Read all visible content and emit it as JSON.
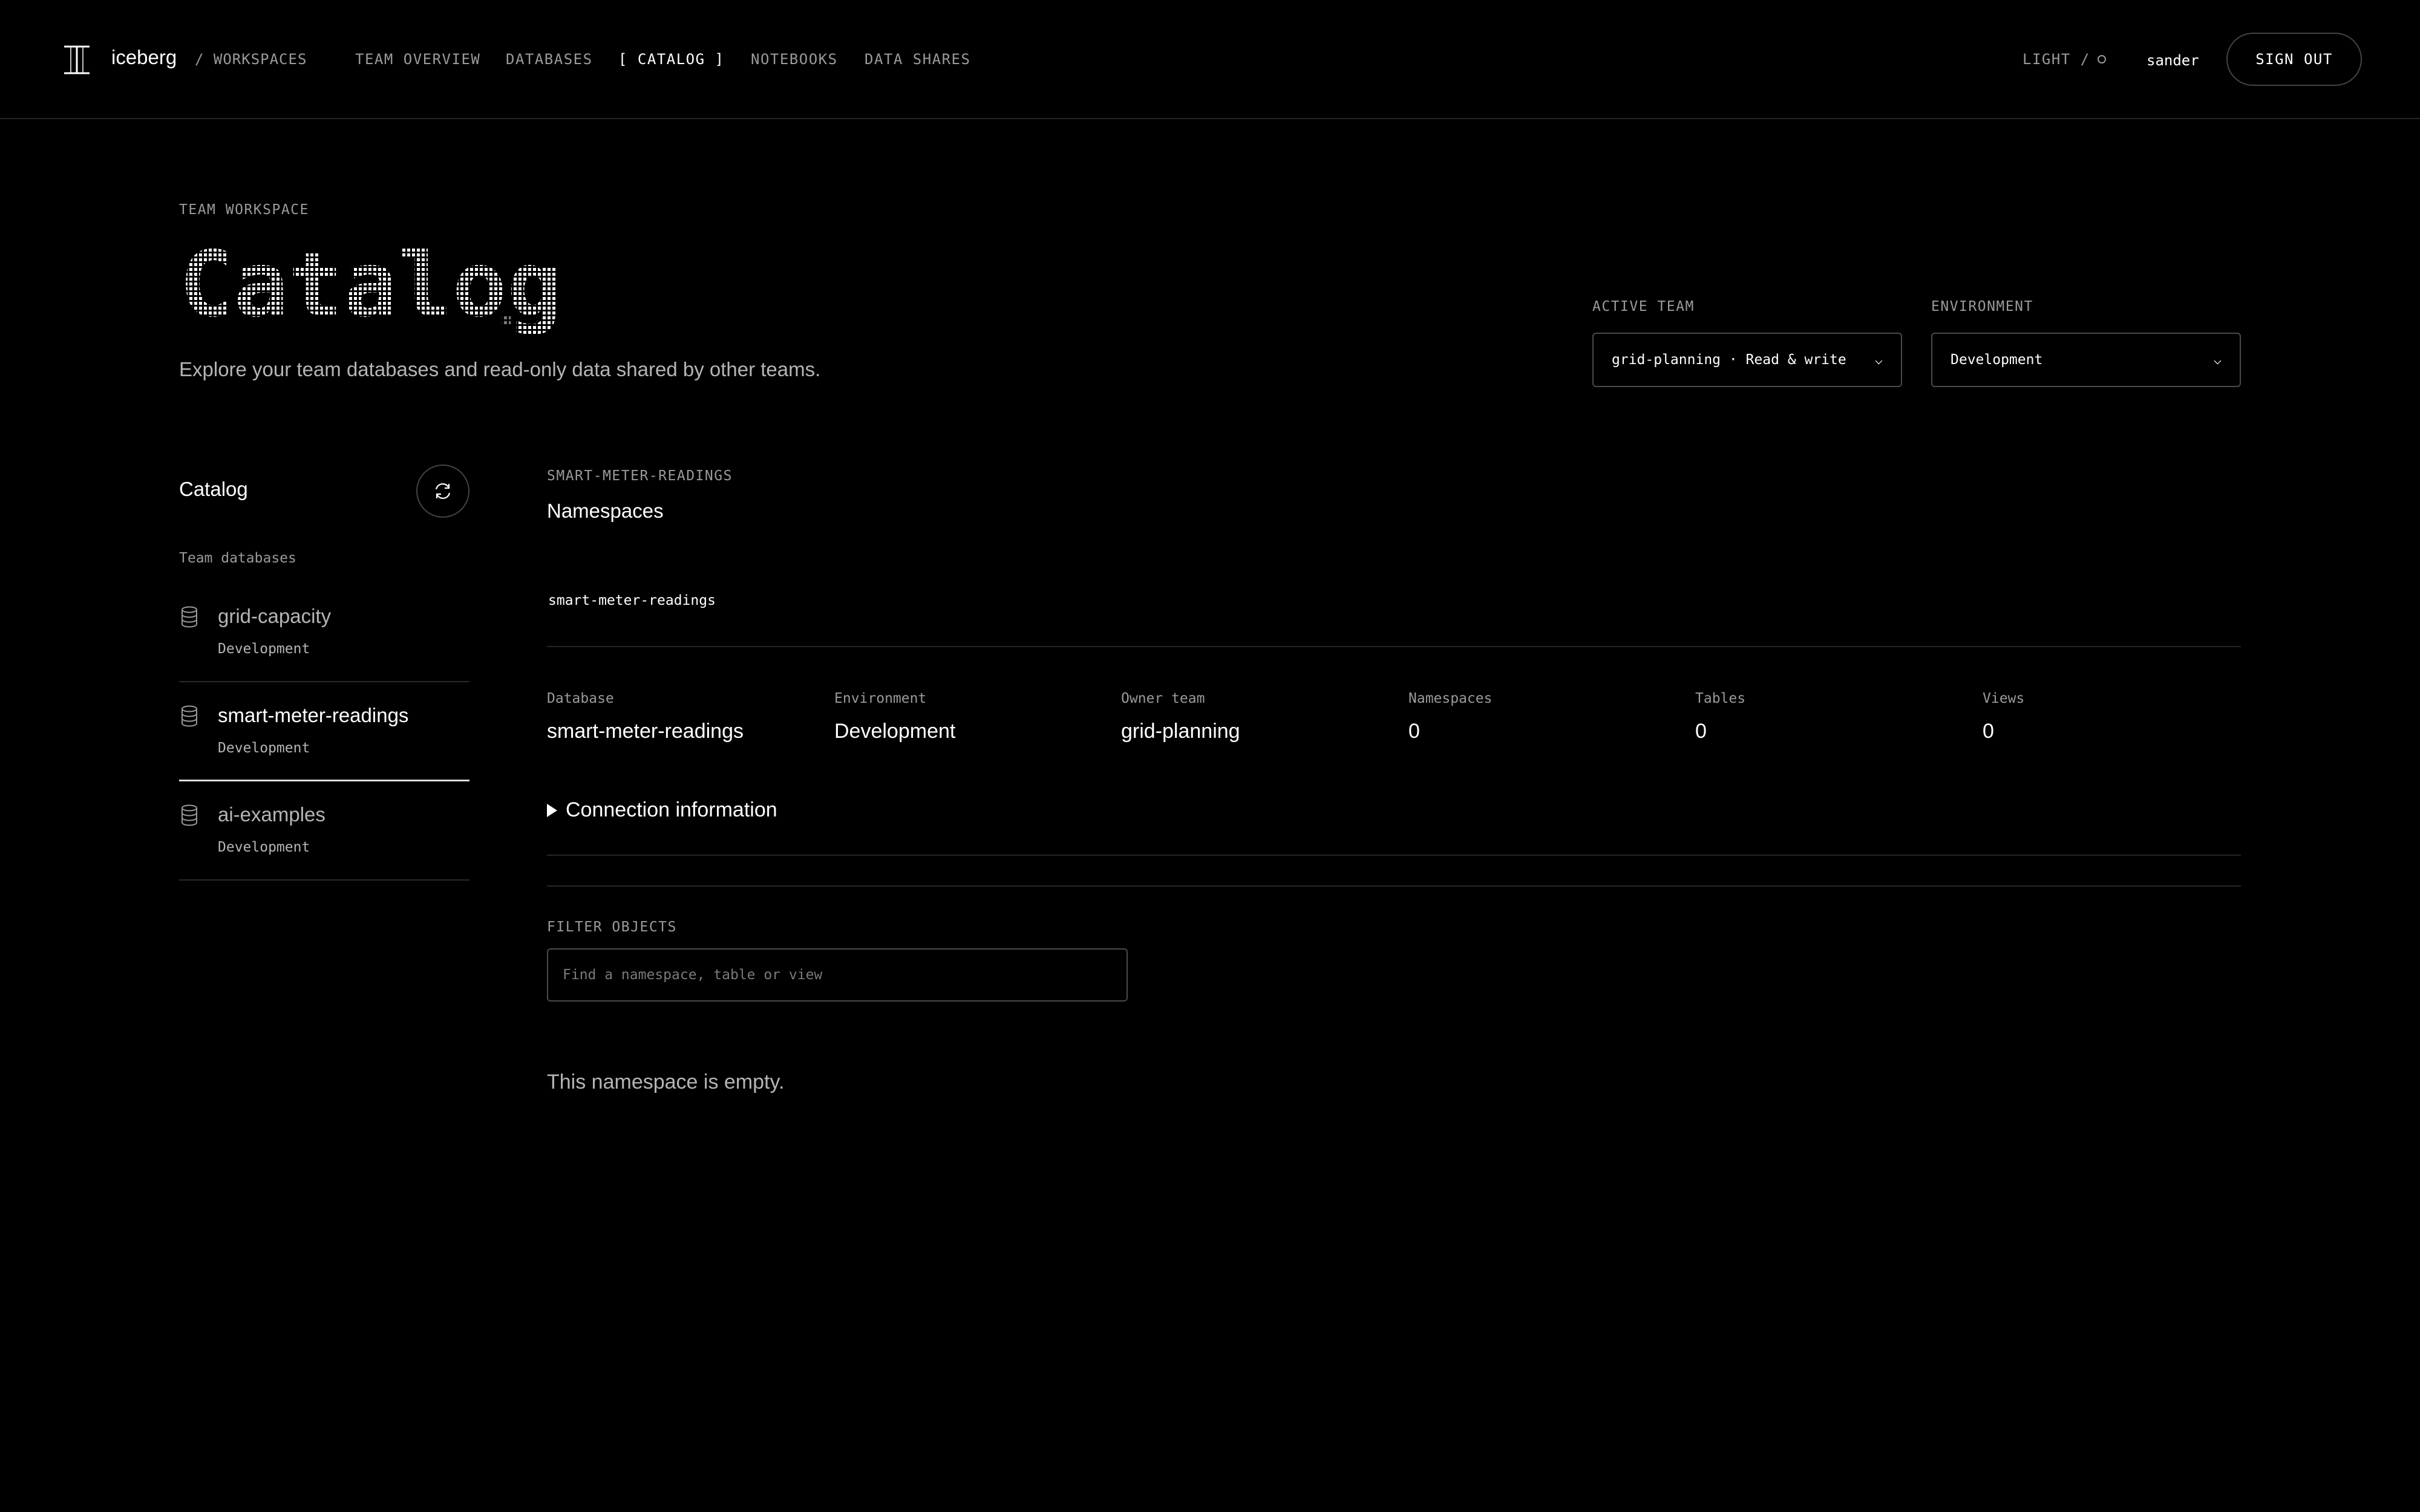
{
  "header": {
    "brand": "iceberg",
    "crumb": "/ WORKSPACES",
    "nav": [
      {
        "label": "TEAM OVERVIEW"
      },
      {
        "label": "DATABASES"
      },
      {
        "label": "[ CATALOG ]"
      },
      {
        "label": "NOTEBOOKS"
      },
      {
        "label": "DATA SHARES"
      }
    ],
    "theme_label": "LIGHT /",
    "user": "sander",
    "signout_label": "SIGN OUT"
  },
  "hero": {
    "eyebrow": "TEAM WORKSPACE",
    "title": "Catalog.",
    "subtitle": "Explore your team databases and read-only data shared by other teams."
  },
  "controls": {
    "active_team_label": "ACTIVE TEAM",
    "active_team_value": "grid-planning · Read & write",
    "environment_label": "ENVIRONMENT",
    "environment_value": "Development"
  },
  "sidebar": {
    "title": "Catalog",
    "section": "Team databases",
    "items": [
      {
        "name": "grid-capacity",
        "env": "Development"
      },
      {
        "name": "smart-meter-readings",
        "env": "Development"
      },
      {
        "name": "ai-examples",
        "env": "Development"
      }
    ]
  },
  "main": {
    "eyebrow": "SMART-METER-READINGS",
    "title": "Namespaces",
    "namespace": "smart-meter-readings",
    "meta": [
      {
        "label": "Database",
        "value": "smart-meter-readings"
      },
      {
        "label": "Environment",
        "value": "Development"
      },
      {
        "label": "Owner team",
        "value": "grid-planning"
      },
      {
        "label": "Namespaces",
        "value": "0"
      },
      {
        "label": "Tables",
        "value": "0"
      },
      {
        "label": "Views",
        "value": "0"
      }
    ],
    "connection_label": "Connection information",
    "filter_label": "FILTER OBJECTS",
    "filter_placeholder": "Find a namespace, table or view",
    "empty_message": "This namespace is empty."
  }
}
